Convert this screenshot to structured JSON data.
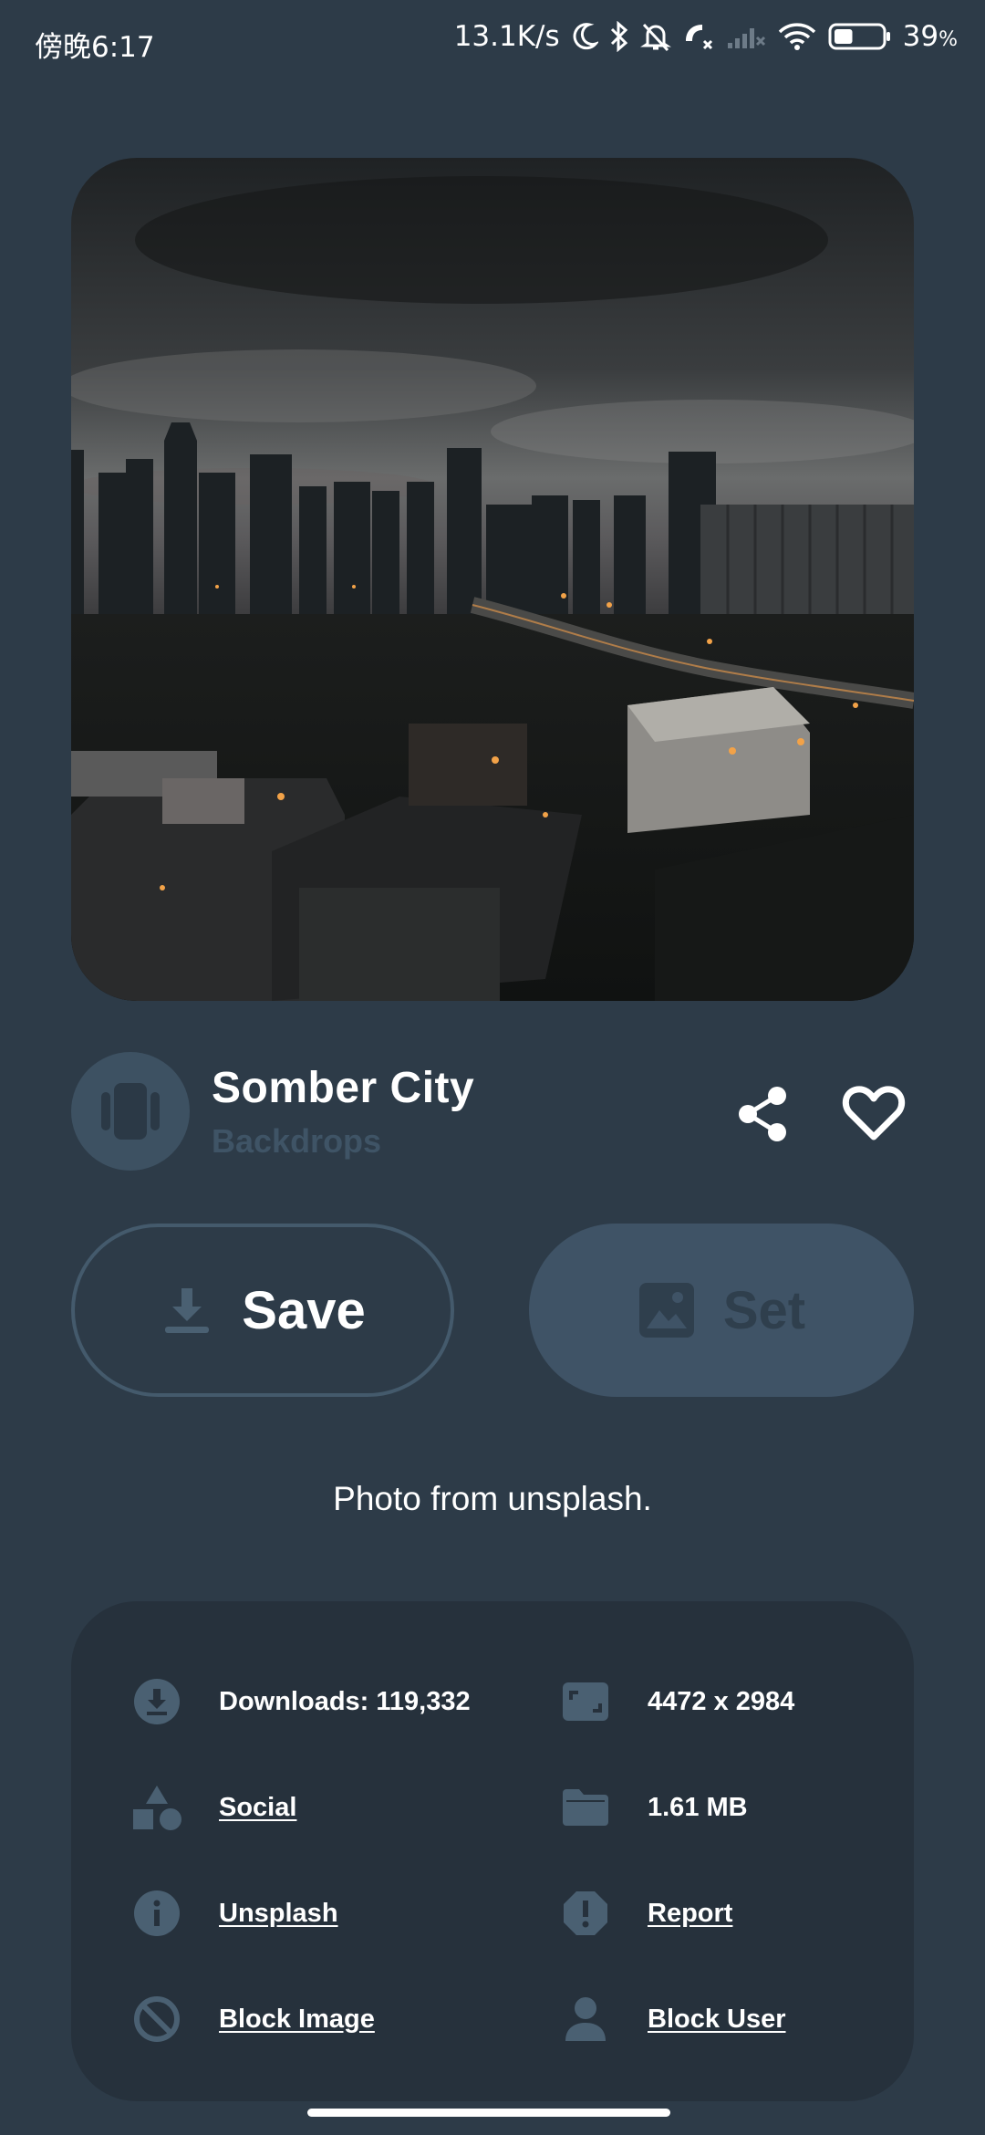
{
  "status_bar": {
    "time": "傍晚6:17",
    "network_speed": "13.1K/s",
    "battery": "39",
    "battery_unit": "%",
    "battery_level": 0.39,
    "icons": [
      "moon-icon",
      "bluetooth-icon",
      "mute-icon",
      "call-icon",
      "signal-icon",
      "wifi-icon",
      "battery-icon"
    ]
  },
  "wallpaper": {
    "title": "Somber City",
    "collection": "Backdrops",
    "image_icon": "city-skyline-photo"
  },
  "actions": {
    "save_label": "Save",
    "set_label": "Set",
    "save_icon": "download-icon",
    "set_icon": "image-icon",
    "share_icon": "share-icon",
    "favorite_icon": "heart-outline-icon"
  },
  "credit": "Photo from unsplash.",
  "details": {
    "downloads": "Downloads: 119,332",
    "resolution": "4472 x 2984",
    "category": "Social",
    "size": "1.61 MB",
    "source": "Unsplash",
    "report": "Report",
    "block_image": "Block Image",
    "block_user": "Block User"
  },
  "colors": {
    "background": "#2d3b48",
    "card": "#26313c",
    "accent_muted": "#3f5366",
    "icon_muted": "#4a6072"
  }
}
